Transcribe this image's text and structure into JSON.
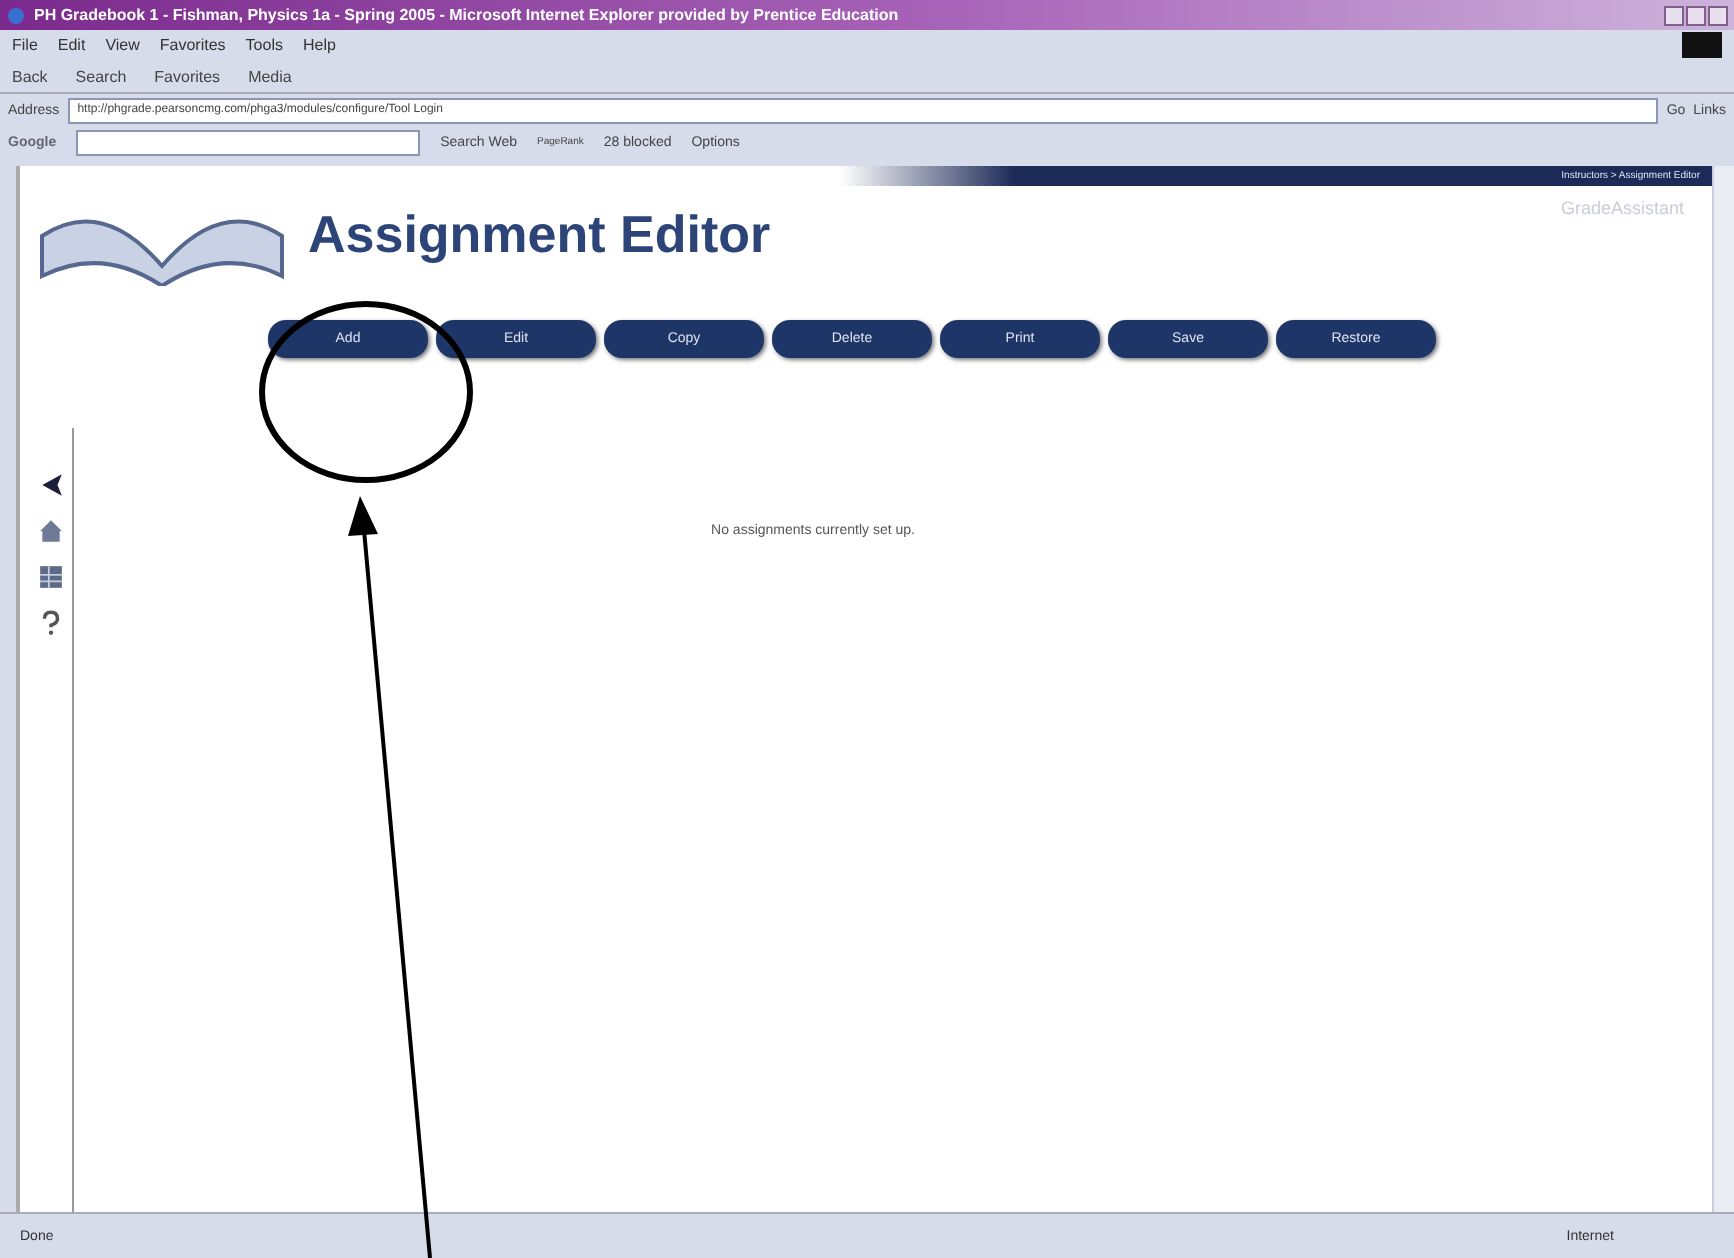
{
  "window": {
    "title": "PH Gradebook 1 - Fishman, Physics 1a - Spring 2005 - Microsoft Internet Explorer provided by Prentice Education"
  },
  "menu": [
    "File",
    "Edit",
    "View",
    "Favorites",
    "Tools",
    "Help"
  ],
  "toolbar": [
    "Back",
    "Search",
    "Favorites",
    "Media"
  ],
  "address_bar": {
    "label": "Address",
    "value": "http://phgrade.pearsoncmg.com/phga3/modules/configure/Tool Login",
    "go": "Go",
    "links": "Links"
  },
  "google_toolbar": {
    "brand": "Google",
    "search": "Search Web",
    "pagerank": "PageRank",
    "blocked": "28 blocked",
    "options": "Options"
  },
  "page": {
    "breadcrumb": "Instructors > Assignment Editor",
    "brand": "GradeAssistant",
    "title": "Assignment Editor",
    "buttons": [
      "Add",
      "Edit",
      "Copy",
      "Delete",
      "Print",
      "Save",
      "Restore"
    ],
    "message": "No assignments currently set up."
  },
  "status_bar": {
    "status": "Done",
    "zone": "Internet"
  }
}
